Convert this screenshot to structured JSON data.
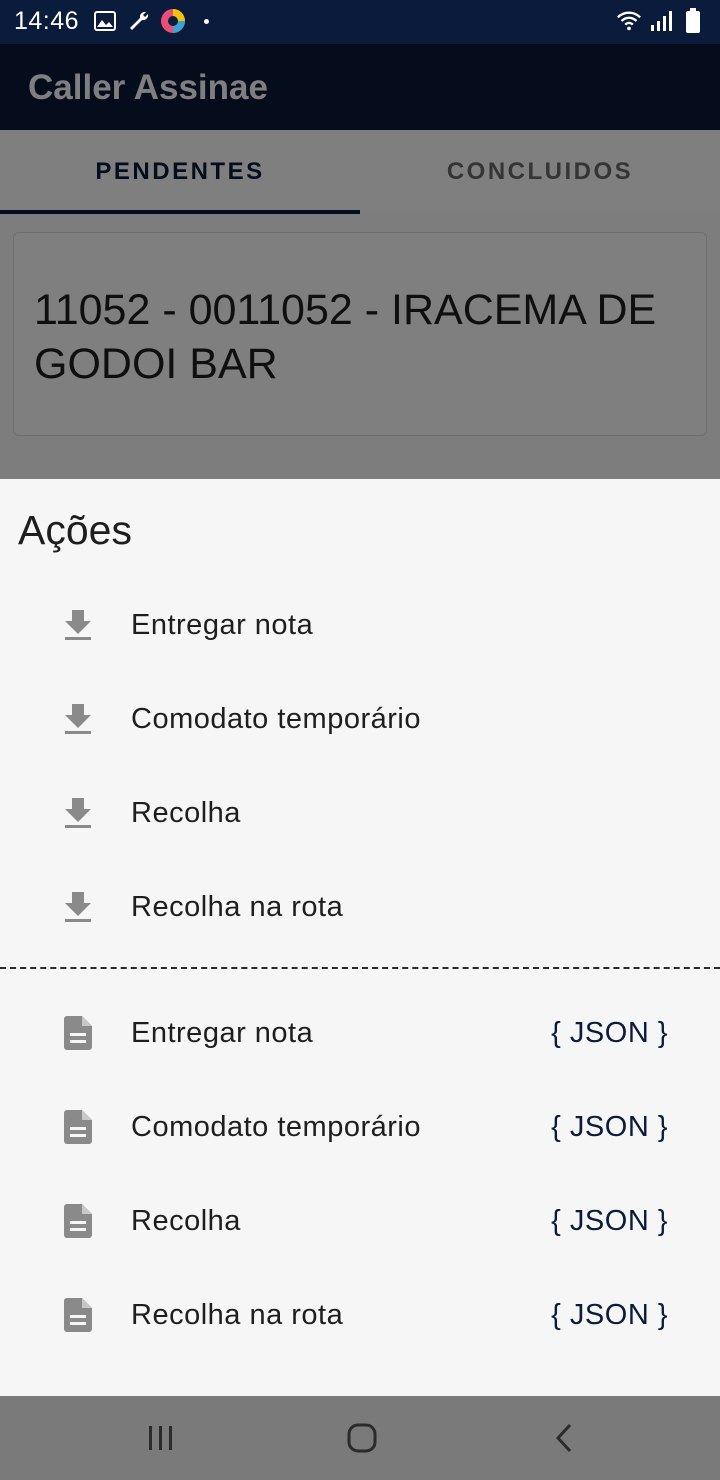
{
  "status_bar": {
    "time": "14:46",
    "icons_left": [
      "image-icon",
      "wrench-icon",
      "app-badge-icon",
      "dot-icon"
    ],
    "icons_right": [
      "wifi-icon",
      "signal-icon",
      "battery-icon"
    ]
  },
  "app_bar": {
    "title": "Caller Assinae"
  },
  "tabs": [
    {
      "label": "PENDENTES",
      "active": true
    },
    {
      "label": "CONCLUIDOS",
      "active": false
    }
  ],
  "card": {
    "text": "11052 - 0011052 - IRACEMA DE GODOI BAR"
  },
  "sheet": {
    "title": "Ações",
    "download_actions": [
      {
        "label": "Entregar nota",
        "icon": "download-icon"
      },
      {
        "label": "Comodato temporário",
        "icon": "download-icon"
      },
      {
        "label": "Recolha",
        "icon": "download-icon"
      },
      {
        "label": "Recolha na rota",
        "icon": "download-icon"
      }
    ],
    "json_actions": [
      {
        "label": "Entregar nota",
        "icon": "document-icon",
        "link": "{ JSON }"
      },
      {
        "label": "Comodato temporário",
        "icon": "document-icon",
        "link": "{ JSON }"
      },
      {
        "label": "Recolha",
        "icon": "document-icon",
        "link": "{ JSON }"
      },
      {
        "label": "Recolha na rota",
        "icon": "document-icon",
        "link": "{ JSON }"
      }
    ]
  },
  "nav_bar": {
    "buttons": [
      "recents-icon",
      "home-icon",
      "back-icon"
    ]
  },
  "colors": {
    "primary": "#0b1b3b",
    "sheet_bg": "#f6f6f6",
    "icon_gray": "#8a8a8a"
  }
}
